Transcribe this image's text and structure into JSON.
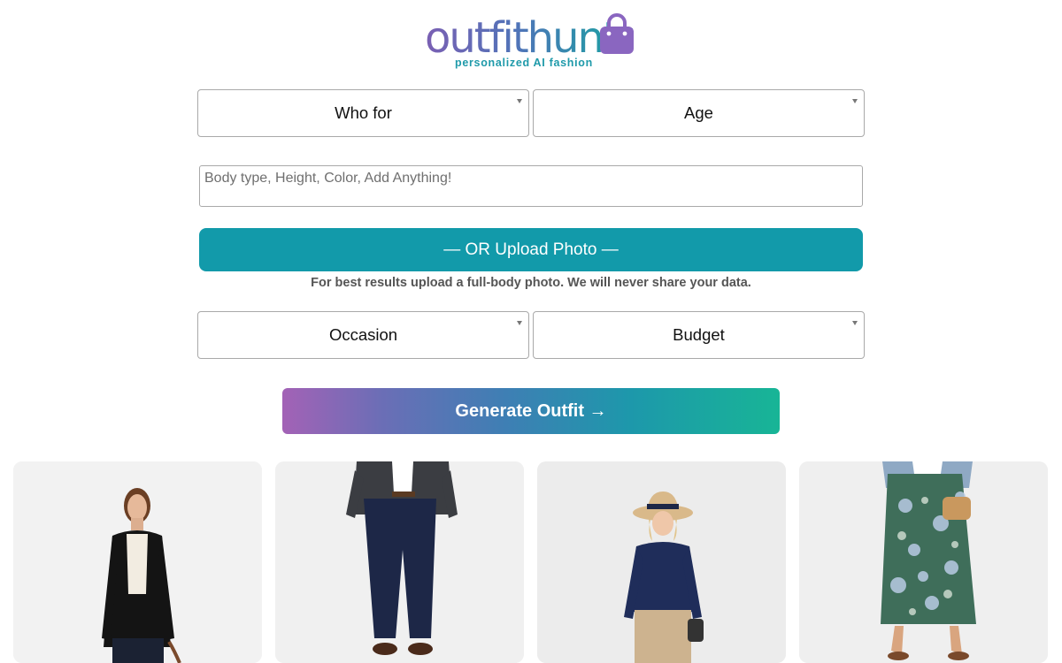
{
  "brand": {
    "name": "outfithuntr",
    "tagline": "personalized AI fashion",
    "bag_icon": "shopping-bag-icon"
  },
  "form": {
    "who_for": "Who for",
    "age": "Age",
    "details_placeholder": "Body type, Height, Color, Add Anything!",
    "upload_label": "— OR Upload Photo —",
    "upload_hint": "For best results upload a full-body photo. We will never share your data.",
    "occasion": "Occasion",
    "budget": "Budget",
    "generate_label": "Generate Outfit →"
  },
  "colors": {
    "upload_button": "#129aaa",
    "generate_gradient_start": "#a362b6",
    "generate_gradient_end": "#18b596",
    "brand_purple": "#7a5fb3",
    "brand_teal": "#14a6a0"
  },
  "gallery": [
    {
      "name": "woman in black blazer outfit"
    },
    {
      "name": "man in grey blazer and navy trousers outfit"
    },
    {
      "name": "woman in straw hat and navy shirt outfit"
    },
    {
      "name": "woman in floral maxi skirt outfit"
    }
  ]
}
